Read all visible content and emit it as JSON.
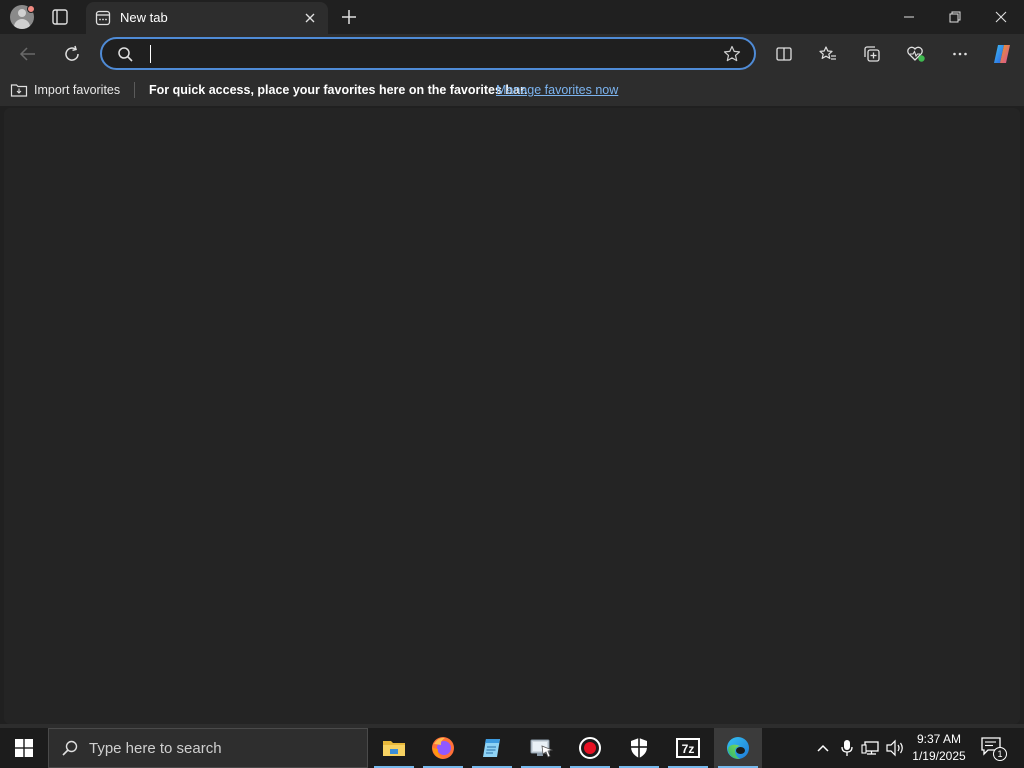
{
  "browser": {
    "tab": {
      "title": "New tab"
    },
    "address_bar": {
      "value": "",
      "placeholder": ""
    },
    "favorites_bar": {
      "import_label": "Import favorites",
      "hint": "For quick access, place your favorites here on the favorites bar.",
      "manage_link": "Manage favorites now"
    },
    "accent_color": "#4f8bd6"
  },
  "taskbar": {
    "search_placeholder": "Type here to search",
    "apps": [
      "file-explorer-icon",
      "firefox-icon",
      "notepad-icon",
      "app-icon",
      "record-icon",
      "security-icon",
      "7zip-icon",
      "edge-icon"
    ],
    "app_labels": {
      "sevenzip": "7z"
    },
    "clock": {
      "time": "9:37 AM",
      "date": "1/19/2025"
    },
    "notification_count": "1"
  }
}
